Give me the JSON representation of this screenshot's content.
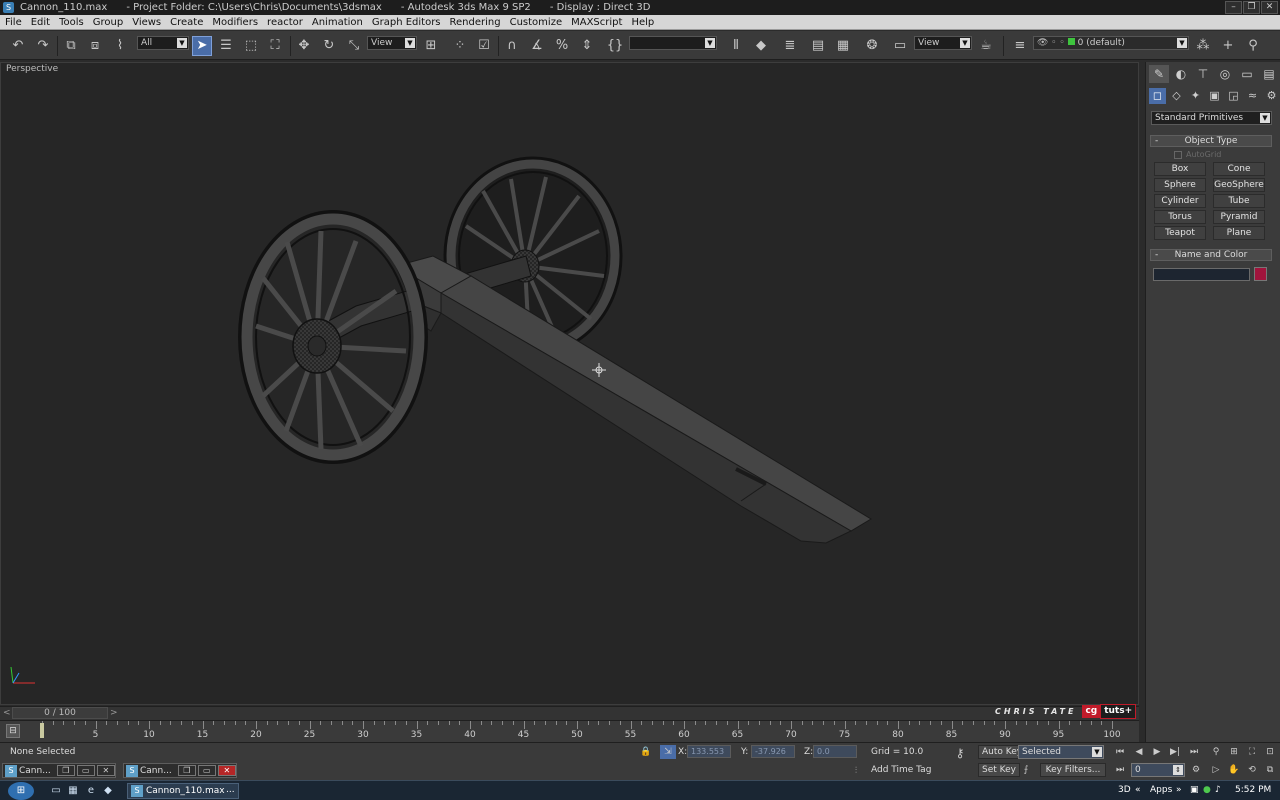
{
  "titlebar": {
    "text": "Cannon_110.max      - Project Folder: C:\\Users\\Chris\\Documents\\3dsmax      - Autodesk 3ds Max 9 SP2      - Display : Direct 3D",
    "minimize": "–",
    "restore": "❐",
    "close": "✕"
  },
  "menu": [
    "File",
    "Edit",
    "Tools",
    "Group",
    "Views",
    "Create",
    "Modifiers",
    "reactor",
    "Animation",
    "Graph Editors",
    "Rendering",
    "Customize",
    "MAXScript",
    "Help"
  ],
  "toolbar": {
    "selection_filter": "All",
    "ref_coord": "View",
    "named_selection": "",
    "render_view": "View",
    "layer": "0 (default)"
  },
  "viewport": {
    "label": "Perspective"
  },
  "command_panel": {
    "category": "Standard Primitives",
    "object_type_title": "Object Type",
    "autogrid": "AutoGrid",
    "buttons": [
      "Box",
      "Cone",
      "Sphere",
      "GeoSphere",
      "Cylinder",
      "Tube",
      "Torus",
      "Pyramid",
      "Teapot",
      "Plane"
    ],
    "name_color_title": "Name and Color",
    "name_value": "",
    "object_color": "#a0143c"
  },
  "timeline": {
    "frame_display": "0 / 100",
    "prev": "<",
    "next": ">",
    "ticks": [
      "5",
      "10",
      "15",
      "20",
      "25",
      "30",
      "35",
      "40",
      "45",
      "50",
      "55",
      "60",
      "65",
      "70",
      "75",
      "80",
      "85",
      "90",
      "95",
      "100"
    ],
    "current_frame": 0,
    "total_frames": 100
  },
  "watermark": {
    "author": "CHRIS TATE",
    "brand_a": "cg",
    "brand_b": "tuts+"
  },
  "status": {
    "selection": "None Selected",
    "x_label": "X:",
    "x_value": "133.553",
    "y_label": "Y:",
    "y_value": "-37.926",
    "z_label": "Z:",
    "z_value": "0.0",
    "grid": "Grid = 10.0",
    "add_time_tag": "Add Time Tag",
    "auto_key": "Auto Key",
    "set_key": "Set Key",
    "key_mode": "Selected",
    "key_filters": "Key Filters...",
    "frame_field": "0"
  },
  "mini_windows": [
    {
      "title": "Cann..."
    },
    {
      "title": "Cann..."
    }
  ],
  "taskbar": {
    "task": "Cannon_110.max",
    "overflow": "...",
    "lang": "3D",
    "apps": "Apps",
    "time": "5:52 PM"
  }
}
